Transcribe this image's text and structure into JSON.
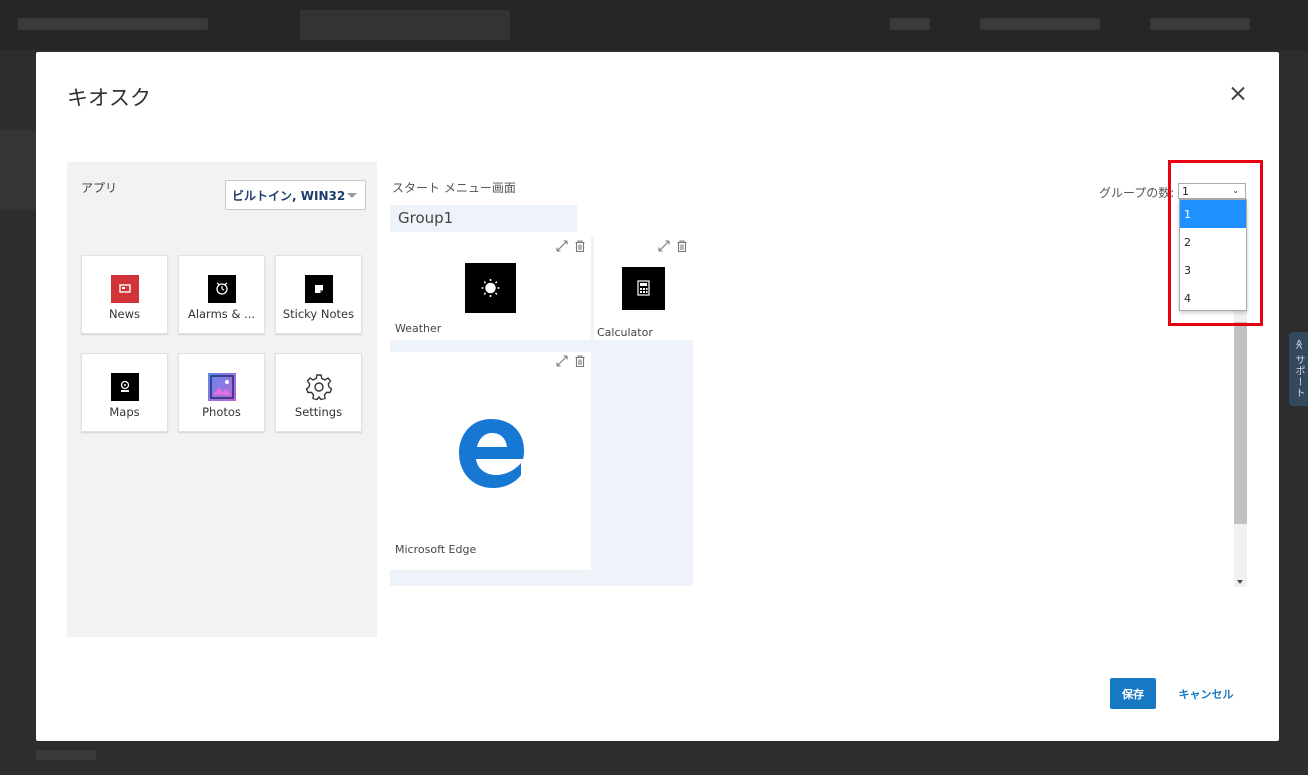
{
  "dialog": {
    "title": "キオスク",
    "close_glyph": "×"
  },
  "apps": {
    "label": "アプリ",
    "filter_value": "ビルトイン, WIN32",
    "items": [
      {
        "label": "News",
        "icon": "news-icon",
        "color": "#d13438"
      },
      {
        "label": "Alarms & ...",
        "icon": "alarm-clock-icon",
        "color": "#000000"
      },
      {
        "label": "Sticky Notes",
        "icon": "sticky-notes-icon",
        "color": "#000000"
      },
      {
        "label": "Maps",
        "icon": "maps-icon",
        "color": "#000000"
      },
      {
        "label": "Photos",
        "icon": "photos-icon",
        "color": "#8a5fd6"
      },
      {
        "label": "Settings",
        "icon": "settings-gear-icon",
        "color": "#333333"
      }
    ]
  },
  "start_menu": {
    "label": "スタート メニュー画面",
    "group_name": "Group1",
    "tiles": [
      {
        "name": "Weather",
        "icon": "weather-sun-icon"
      },
      {
        "name": "Calculator",
        "icon": "calculator-icon"
      },
      {
        "name": "Microsoft Edge",
        "icon": "microsoft-edge-icon"
      }
    ]
  },
  "group_count": {
    "label": "グループの数:",
    "selected": "1",
    "options": [
      "1",
      "2",
      "3",
      "4"
    ]
  },
  "support_tab": "≪ サポート",
  "footer": {
    "save_label": "保存",
    "cancel_label": "キャンセル"
  },
  "colors": {
    "accent": "#1778c3",
    "highlight": "#e60012",
    "dropdown_selected": "#1e90ff"
  }
}
